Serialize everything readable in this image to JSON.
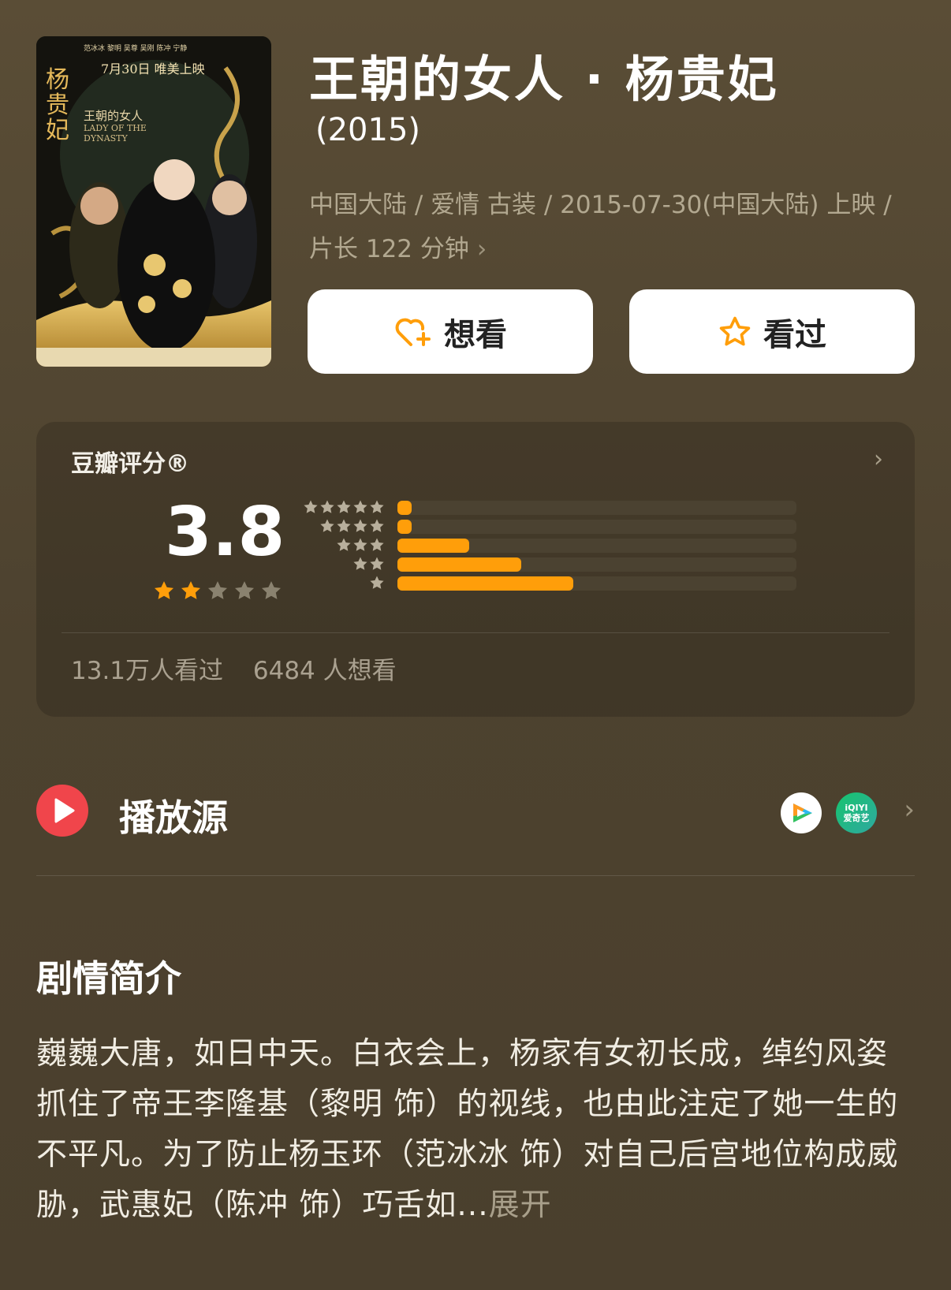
{
  "movie": {
    "title": "王朝的女人 · 杨贵妃",
    "year": "(2015)",
    "meta_line1": "中国大陆 / 爱情 古装 / 2015-07-30(中国大陆) 上映 /",
    "meta_line2": "片长 122 分钟",
    "poster": {
      "top_credits": "范冰冰 黎明 吴尊 吴刚 陈冲 宁静",
      "release": "7月30日 唯美上映",
      "title_cn": "杨贵妃",
      "subtitle_cn": "王朝的女人",
      "title_en": "LADY OF THE DYNASTY"
    }
  },
  "actions": {
    "want_label": "想看",
    "seen_label": "看过"
  },
  "rating": {
    "label": "豆瓣评分®",
    "score": "3.8",
    "star_fill": 2,
    "distribution_percent": [
      3,
      3,
      18,
      31,
      44
    ],
    "watched": "13.1万人看过",
    "wants": "6484 人想看"
  },
  "sources": {
    "label": "播放源",
    "providers": [
      {
        "name": "tencent-video-icon"
      },
      {
        "name": "iqiyi-icon",
        "text_top": "iQIYI",
        "text_bottom": "爱奇艺"
      }
    ]
  },
  "synopsis": {
    "title": "剧情简介",
    "text": "巍巍大唐，如日中天。白衣会上，杨家有女初长成，绰约风姿抓住了帝王李隆基（黎明 饰）的视线，也由此注定了她一生的不平凡。为了防止杨玉环（范冰冰 饰）对自己后宫地位构成威胁，武惠妃（陈冲 饰）巧舌如...",
    "expand_label": "展开"
  },
  "colors": {
    "background": "#4e4330",
    "accent": "#ff9e0a",
    "play_red": "#f0454b"
  }
}
